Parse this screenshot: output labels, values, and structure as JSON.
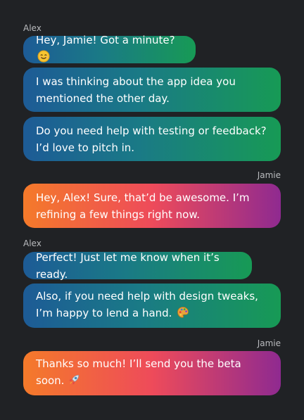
{
  "conversation": {
    "messages": [
      {
        "sender": "Alex",
        "text": "Hey, Jamie! Got a minute?",
        "emoji": "smiling-face-icon"
      },
      {
        "sender": "",
        "text": "I was thinking about the app idea you mentioned the other day."
      },
      {
        "sender": "",
        "text": "Do you need help with testing or feedback? I’d love to pitch in."
      },
      {
        "sender": "Jamie",
        "text": "Hey, Alex! Sure, that’d be awesome. I’m refining a few things right now."
      },
      {
        "sender": "Alex",
        "text": "Perfect! Just let me know when it’s ready."
      },
      {
        "sender": "",
        "text": "Also, if you need help with design tweaks, I’m happy to lend a hand.",
        "emoji": "artist-palette-icon"
      },
      {
        "sender": "Jamie",
        "text": "Thanks so much! I’ll send you the beta soon.",
        "emoji": "rocket-icon"
      }
    ]
  },
  "colors": {
    "background": "#202225",
    "alex_gradient": [
      "#1d5b96",
      "#179a55"
    ],
    "jamie_gradient": [
      "#f47a2a",
      "#ee4b5a",
      "#8f2a90"
    ],
    "sender_label": "#b9bbbe"
  }
}
